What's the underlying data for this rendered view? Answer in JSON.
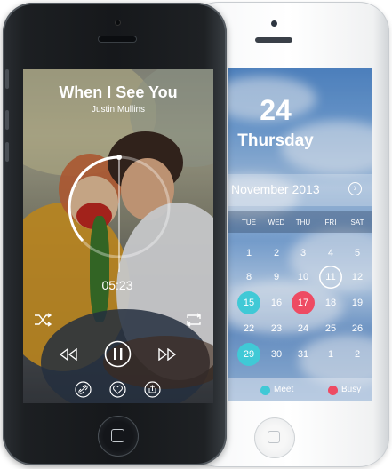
{
  "music_player": {
    "title": "When I See You",
    "artist": "Justin Mullins",
    "elapsed": "05:23",
    "icons": [
      "shuffle-icon",
      "repeat-icon",
      "rewind-icon",
      "pause-icon",
      "fast-forward-icon",
      "link-icon",
      "heart-icon",
      "share-icon"
    ]
  },
  "calendar": {
    "date_number": "24",
    "day_name": "Thursday",
    "month_label": "November 2013",
    "weekdays": [
      "TUE",
      "WED",
      "THU",
      "FRI",
      "SAT"
    ],
    "rows": [
      [
        "1",
        "2",
        "3",
        "4",
        "5"
      ],
      [
        "8",
        "9",
        "10",
        "11",
        "12"
      ],
      [
        "15",
        "16",
        "17",
        "18",
        "19"
      ],
      [
        "22",
        "23",
        "24",
        "25",
        "26"
      ],
      [
        "29",
        "30",
        "31",
        "1",
        "2"
      ]
    ],
    "grid_rows": [
      [
        "",
        "",
        "",
        "",
        ""
      ],
      [
        "",
        "",
        "",
        "",
        ""
      ],
      [
        "",
        "",
        "",
        "",
        ""
      ],
      [
        "",
        "",
        "",
        "",
        ""
      ],
      [
        "",
        "",
        "",
        "",
        ""
      ]
    ],
    "legend": {
      "meet": "Meet",
      "busy": "Busy"
    },
    "colors": {
      "meet": "#40c9d6",
      "busy": "#ee4b63"
    }
  }
}
